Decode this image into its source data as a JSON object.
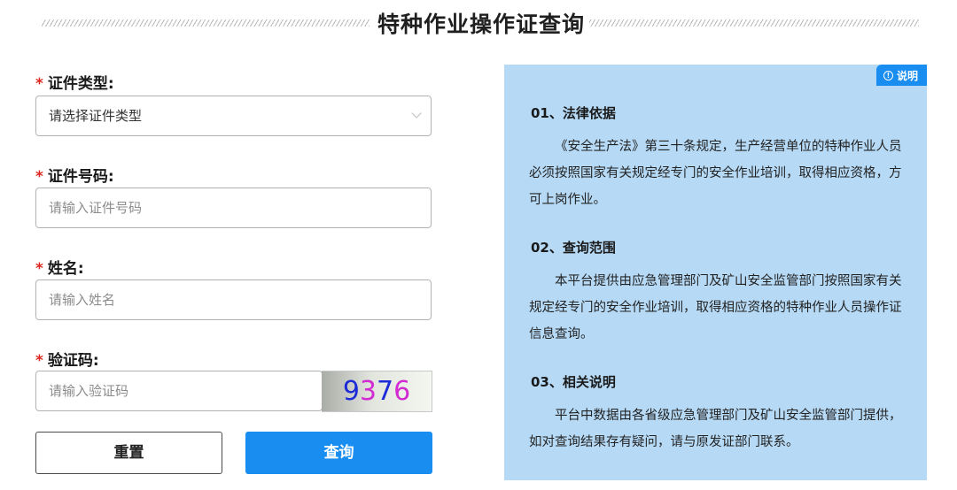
{
  "page": {
    "title": "特种作业操作证查询"
  },
  "form": {
    "required_mark": "*",
    "cert_type": {
      "label": "证件类型:",
      "placeholder": "请选择证件类型"
    },
    "cert_number": {
      "label": "证件号码:",
      "placeholder": "请输入证件号码"
    },
    "name": {
      "label": "姓名:",
      "placeholder": "请输入姓名"
    },
    "captcha": {
      "label": "验证码:",
      "placeholder": "请输入验证码",
      "image_chars": [
        {
          "char": "9",
          "color": "#1d2bd6"
        },
        {
          "char": "3",
          "color": "#d12bd1"
        },
        {
          "char": "7",
          "color": "#1d2bd6"
        },
        {
          "char": "6",
          "color": "#d12bd1"
        }
      ]
    },
    "reset_label": "重置",
    "query_label": "查询"
  },
  "info": {
    "badge_icon_char": "!",
    "badge_label": "说明",
    "sections": [
      {
        "title": "01、法律依据",
        "body": "《安全生产法》第三十条规定，生产经营单位的特种作业人员必须按照国家有关规定经专门的安全作业培训，取得相应资格，方可上岗作业。"
      },
      {
        "title": "02、查询范围",
        "body": "本平台提供由应急管理部门及矿山安全监管部门按照国家有关规定经专门的安全作业培训，取得相应资格的特种作业人员操作证信息查询。"
      },
      {
        "title": "03、相关说明",
        "body": "平台中数据由各省级应急管理部门及矿山安全监管部门提供，如对查询结果存有疑问，请与原发证部门联系。"
      }
    ]
  },
  "colors": {
    "accent": "#1a8df0",
    "panel_bg": "#b6daf6",
    "required": "#e0271f"
  }
}
